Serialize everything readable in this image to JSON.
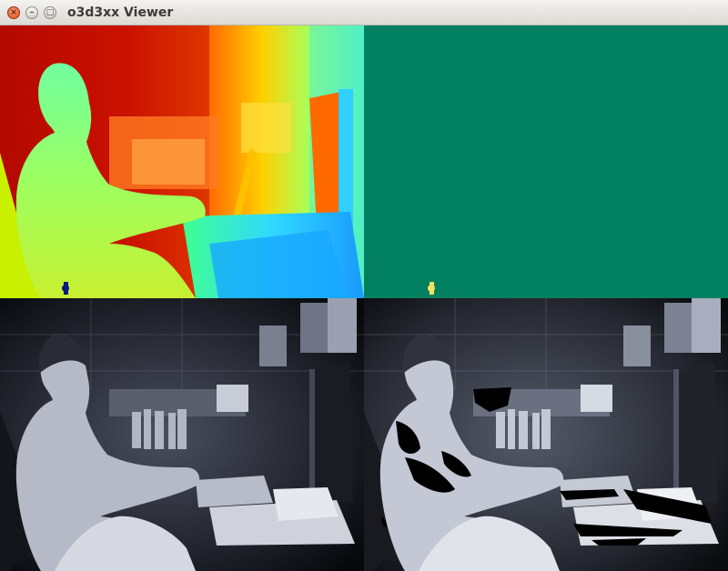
{
  "window": {
    "title": "o3d3xx Viewer",
    "close_glyph": "×",
    "minimize_glyph": "–",
    "maximize_glyph": "□"
  },
  "views": [
    {
      "id": "depth",
      "colormap": "jet"
    },
    {
      "id": "confidence",
      "fill_color": "#008060"
    },
    {
      "id": "amplitude",
      "colormap": "bone"
    },
    {
      "id": "amplitude-masked",
      "colormap": "bone",
      "mask_color": "#000000"
    }
  ],
  "colors": {
    "accent_close": "#df4b16",
    "titlebar": "#e6e4df",
    "confidence_fill": "#008060"
  }
}
